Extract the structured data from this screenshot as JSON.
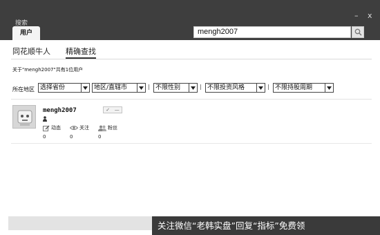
{
  "window": {
    "title": "搜索",
    "minimize_glyph": "–",
    "close_glyph": "x"
  },
  "tabs": [
    {
      "label": "用户"
    }
  ],
  "search": {
    "value": "mengh2007",
    "icon": "magnifier-icon"
  },
  "subnav": [
    {
      "label": "同花顺牛人"
    },
    {
      "label": "精确查找"
    }
  ],
  "result_summary": "关于\"mengh2007\"共有1位用户",
  "filters": {
    "label": "所在地区",
    "selects": [
      {
        "value": "选择省份"
      },
      {
        "value": "地区/直辖市"
      },
      {
        "value": "不限性别"
      },
      {
        "value": "不限投资风格"
      },
      {
        "value": "不限持股周期"
      }
    ],
    "separator": "|"
  },
  "user": {
    "name": "mengh2007",
    "actions": [
      "✓",
      "—"
    ],
    "stats": [
      {
        "label": "动态",
        "icon": "edit-icon",
        "value": "0"
      },
      {
        "label": "关注",
        "icon": "eye-icon",
        "value": "0"
      },
      {
        "label": "粉丝",
        "icon": "group-icon",
        "value": "0"
      }
    ]
  },
  "banner": {
    "text": "关注微信“老韩实盘”回复“指标”免费领"
  },
  "colors": {
    "titlebar": "#3e3e3e",
    "banner": "#3a3a3a",
    "bottom_bar": "#e3e3e3"
  }
}
